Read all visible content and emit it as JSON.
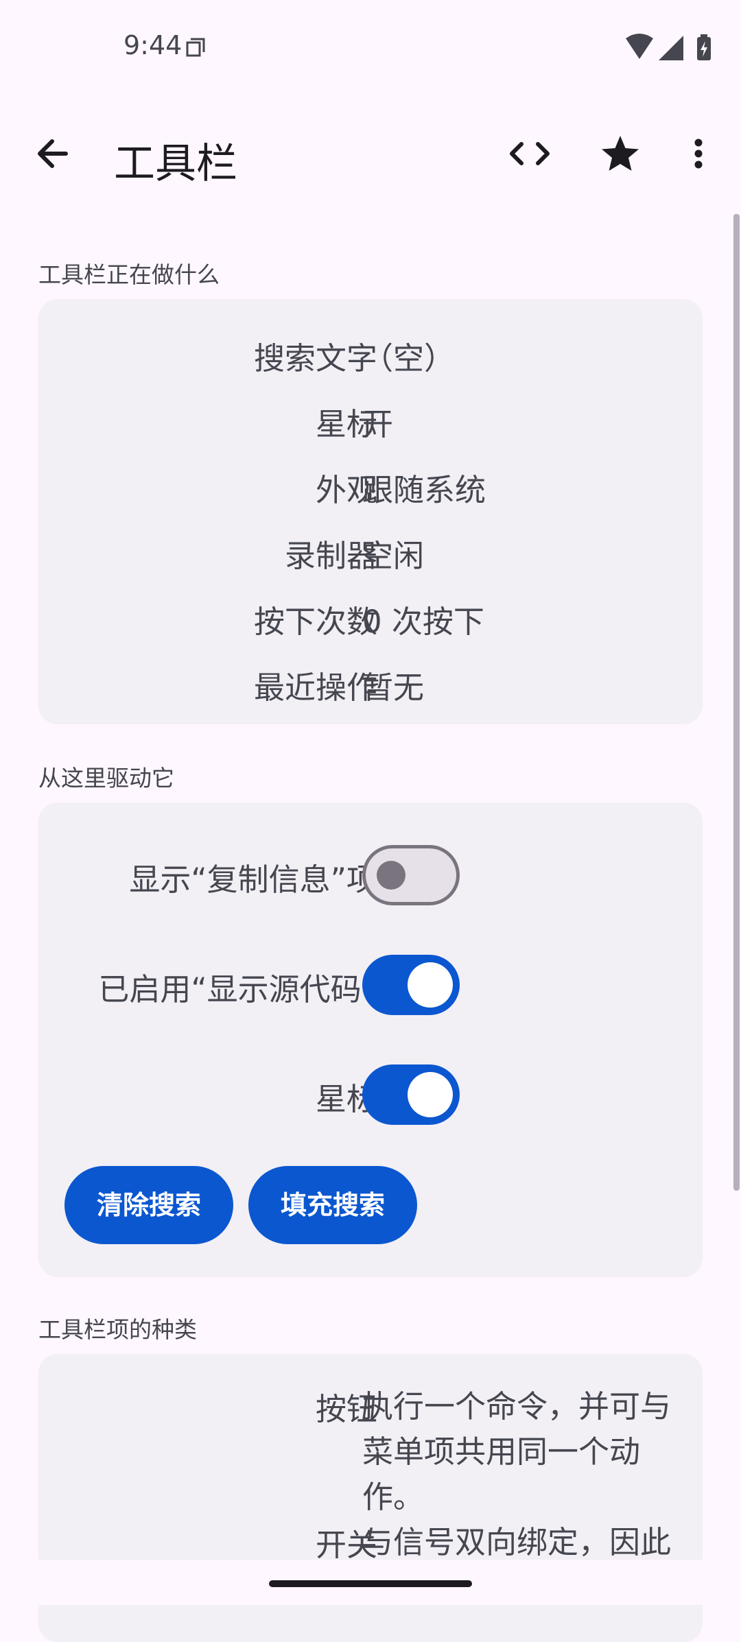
{
  "status_bar": {
    "time": "9:44",
    "icons": [
      "sim-card-icon",
      "wifi-icon",
      "signal-icon",
      "battery-charging-icon"
    ]
  },
  "app_bar": {
    "title": "工具栏",
    "back_icon": "arrow-back-icon",
    "actions": [
      "code-icon",
      "star-icon",
      "more-vert-icon"
    ]
  },
  "status_section": {
    "label": "工具栏正在做什么",
    "rows": [
      {
        "key": "搜索文字",
        "value": "（空）"
      },
      {
        "key": "星标",
        "value": "开"
      },
      {
        "key": "外观",
        "value": "跟随系统"
      },
      {
        "key": "录制器",
        "value": "空闲"
      },
      {
        "key": "按下次数",
        "value": "0 次按下"
      },
      {
        "key": "最近操作",
        "value": "暂无"
      }
    ]
  },
  "drive_section": {
    "label": "从这里驱动它",
    "switches": [
      {
        "label": "显示“复制信息”项",
        "on": false
      },
      {
        "label": "已启用“显示源代码”",
        "on": true
      },
      {
        "label": "星标",
        "on": true
      }
    ],
    "buttons": [
      "清除搜索",
      "填充搜索"
    ]
  },
  "kinds_section": {
    "label": "工具栏项的种类",
    "rows": [
      {
        "key": "按钮",
        "value": "执行一个命令，并可与菜单项共用同一个动作。"
      },
      {
        "key": "开关",
        "value": "与信号双向绑定，因此"
      }
    ]
  },
  "colors": {
    "background": "#FEF7FF",
    "card": "#F2EFF5",
    "accent": "#0B57D0",
    "text": "#1D1B20",
    "secondary_text": "#45464F"
  }
}
